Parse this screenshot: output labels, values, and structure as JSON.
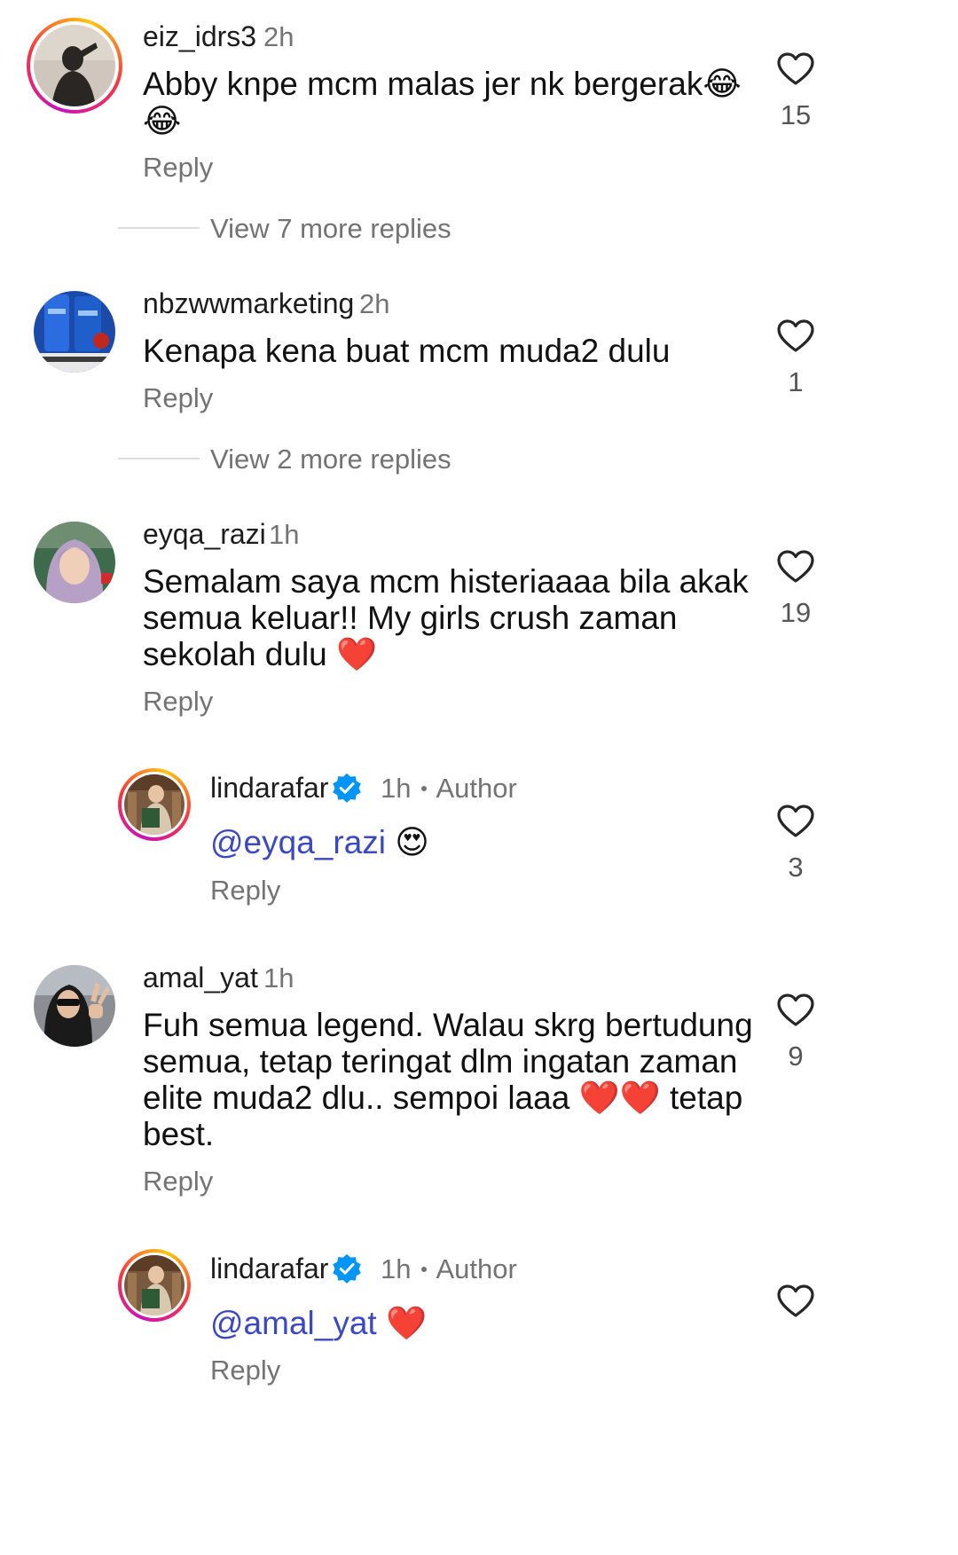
{
  "comments": [
    {
      "username": "eiz_idrs3",
      "time": "2h",
      "text_line1": "Abby knpe mcm malas jer nk bergerak",
      "emoji_line1": "😂",
      "emoji_line2": "😂",
      "reply": "Reply",
      "likes": "15",
      "view_replies": "View 7 more replies"
    },
    {
      "username": "nbzwwmarketing",
      "time": "2h",
      "text": "Kenapa kena buat mcm muda2 dulu",
      "reply": "Reply",
      "likes": "1",
      "view_replies": "View 2 more replies"
    },
    {
      "username": "eyqa_razi",
      "time": "1h",
      "lines": [
        "Semalam saya mcm histeriaaaa bila akak",
        "semua keluar!! My girls crush zaman",
        "sekolah dulu"
      ],
      "emoji": "❤️",
      "reply": "Reply",
      "likes": "19",
      "author_reply": {
        "username": "lindarafar",
        "time": "1h",
        "badge": "Author",
        "mention": "@eyqa_razi",
        "emoji": "😍",
        "reply": "Reply",
        "likes": "3"
      }
    },
    {
      "username": "amal_yat",
      "time": "1h",
      "lines": [
        "Fuh semua legend. Walau skrg bertudung",
        "semua, tetap teringat dlm ingatan zaman",
        "elite muda2 dlu.. sempoi laaa",
        "best."
      ],
      "line3_emoji": "❤️❤️",
      "line3_tail": "tetap",
      "reply": "Reply",
      "likes": "9",
      "author_reply": {
        "username": "lindarafar",
        "time": "1h",
        "badge": "Author",
        "mention": "@amal_yat",
        "emoji": "❤️",
        "reply": "Reply"
      }
    }
  ],
  "icons": {
    "like": "heart-outline-icon",
    "verified": "verified-badge-icon"
  },
  "colors": {
    "mention": "#3b48c6",
    "verified": "#0095f6",
    "secondary_text": "#737373"
  }
}
